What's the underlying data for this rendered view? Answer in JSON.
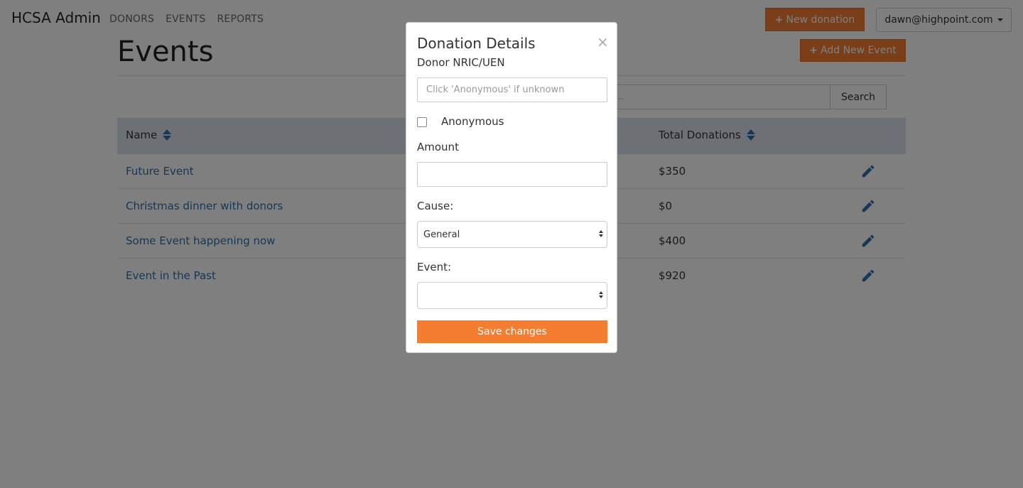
{
  "navbar": {
    "brand": "HCSA Admin",
    "links": [
      "DONORS",
      "EVENTS",
      "REPORTS"
    ],
    "new_donation_label": "New donation",
    "user_email": "dawn@highpoint.com"
  },
  "page": {
    "title": "Events",
    "add_event_label": "Add New Event",
    "search_placeholder": "ame ...",
    "search_button": "Search"
  },
  "table": {
    "headers": {
      "name": "Name",
      "total": "Total Donations"
    },
    "rows": [
      {
        "name": "Future Event",
        "total": "$350"
      },
      {
        "name": "Christmas dinner with donors",
        "total": "$0"
      },
      {
        "name": "Some Event happening now",
        "total": "$400"
      },
      {
        "name": "Event in the Past",
        "total": "$920"
      }
    ]
  },
  "modal": {
    "title": "Donation Details",
    "close": "×",
    "donor_label": "Donor NRIC/UEN",
    "donor_placeholder": "Click 'Anonymous' if unknown",
    "anonymous_label": "Anonymous",
    "amount_label": "Amount",
    "amount_value": "",
    "cause_label": "Cause:",
    "cause_value": "General",
    "event_label": "Event:",
    "event_value": "",
    "save_label": "Save changes"
  },
  "colors": {
    "accent": "#f47d30",
    "link": "#2f6fa8",
    "table_head": "#dbe2ea"
  }
}
